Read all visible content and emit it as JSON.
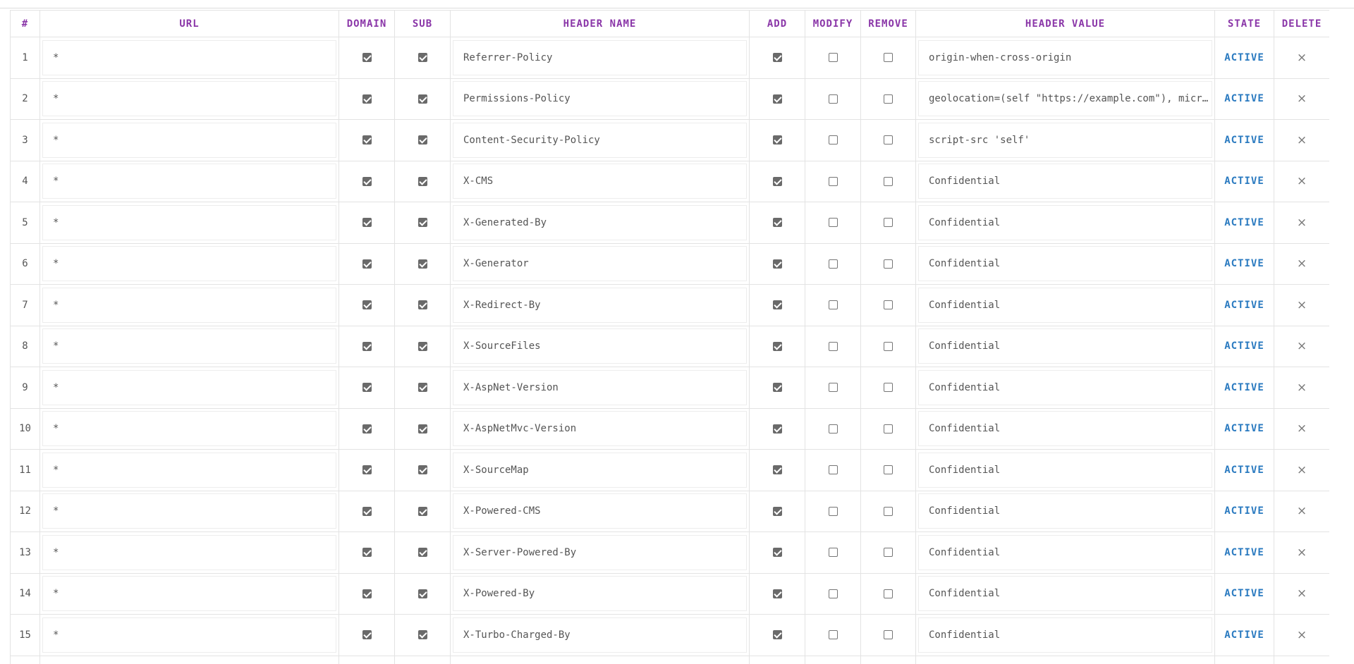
{
  "columns": [
    "#",
    "URL",
    "DOMAIN",
    "SUB",
    "HEADER NAME",
    "ADD",
    "MODIFY",
    "REMOVE",
    "HEADER VALUE",
    "STATE",
    "DELETE"
  ],
  "delete_icon": "close-icon",
  "delete_glyph": "×",
  "colors": {
    "header_text": "#8a36a8",
    "state_text": "#2a7ac0",
    "checkbox_checked": "#6a6a6a"
  },
  "rows": [
    {
      "index": "1",
      "url": "*",
      "domain": true,
      "sub": true,
      "header_name": "Referrer-Policy",
      "add": true,
      "modify": false,
      "remove": false,
      "header_value": "origin-when-cross-origin",
      "state": "ACTIVE"
    },
    {
      "index": "2",
      "url": "*",
      "domain": true,
      "sub": true,
      "header_name": "Permissions-Policy",
      "add": true,
      "modify": false,
      "remove": false,
      "header_value": "geolocation=(self \"https://example.com\"), micro…",
      "state": "ACTIVE"
    },
    {
      "index": "3",
      "url": "*",
      "domain": true,
      "sub": true,
      "header_name": "Content-Security-Policy",
      "add": true,
      "modify": false,
      "remove": false,
      "header_value": "script-src 'self'",
      "state": "ACTIVE"
    },
    {
      "index": "4",
      "url": "*",
      "domain": true,
      "sub": true,
      "header_name": "X-CMS",
      "add": true,
      "modify": false,
      "remove": false,
      "header_value": "Confidential",
      "state": "ACTIVE"
    },
    {
      "index": "5",
      "url": "*",
      "domain": true,
      "sub": true,
      "header_name": "X-Generated-By",
      "add": true,
      "modify": false,
      "remove": false,
      "header_value": "Confidential",
      "state": "ACTIVE"
    },
    {
      "index": "6",
      "url": "*",
      "domain": true,
      "sub": true,
      "header_name": "X-Generator",
      "add": true,
      "modify": false,
      "remove": false,
      "header_value": "Confidential",
      "state": "ACTIVE"
    },
    {
      "index": "7",
      "url": "*",
      "domain": true,
      "sub": true,
      "header_name": "X-Redirect-By",
      "add": true,
      "modify": false,
      "remove": false,
      "header_value": "Confidential",
      "state": "ACTIVE"
    },
    {
      "index": "8",
      "url": "*",
      "domain": true,
      "sub": true,
      "header_name": "X-SourceFiles",
      "add": true,
      "modify": false,
      "remove": false,
      "header_value": "Confidential",
      "state": "ACTIVE"
    },
    {
      "index": "9",
      "url": "*",
      "domain": true,
      "sub": true,
      "header_name": "X-AspNet-Version",
      "add": true,
      "modify": false,
      "remove": false,
      "header_value": "Confidential",
      "state": "ACTIVE"
    },
    {
      "index": "10",
      "url": "*",
      "domain": true,
      "sub": true,
      "header_name": "X-AspNetMvc-Version",
      "add": true,
      "modify": false,
      "remove": false,
      "header_value": "Confidential",
      "state": "ACTIVE"
    },
    {
      "index": "11",
      "url": "*",
      "domain": true,
      "sub": true,
      "header_name": "X-SourceMap",
      "add": true,
      "modify": false,
      "remove": false,
      "header_value": "Confidential",
      "state": "ACTIVE"
    },
    {
      "index": "12",
      "url": "*",
      "domain": true,
      "sub": true,
      "header_name": "X-Powered-CMS",
      "add": true,
      "modify": false,
      "remove": false,
      "header_value": "Confidential",
      "state": "ACTIVE"
    },
    {
      "index": "13",
      "url": "*",
      "domain": true,
      "sub": true,
      "header_name": "X-Server-Powered-By",
      "add": true,
      "modify": false,
      "remove": false,
      "header_value": "Confidential",
      "state": "ACTIVE"
    },
    {
      "index": "14",
      "url": "*",
      "domain": true,
      "sub": true,
      "header_name": "X-Powered-By",
      "add": true,
      "modify": false,
      "remove": false,
      "header_value": "Confidential",
      "state": "ACTIVE"
    },
    {
      "index": "15",
      "url": "*",
      "domain": true,
      "sub": true,
      "header_name": "X-Turbo-Charged-By",
      "add": true,
      "modify": false,
      "remove": false,
      "header_value": "Confidential",
      "state": "ACTIVE"
    }
  ]
}
